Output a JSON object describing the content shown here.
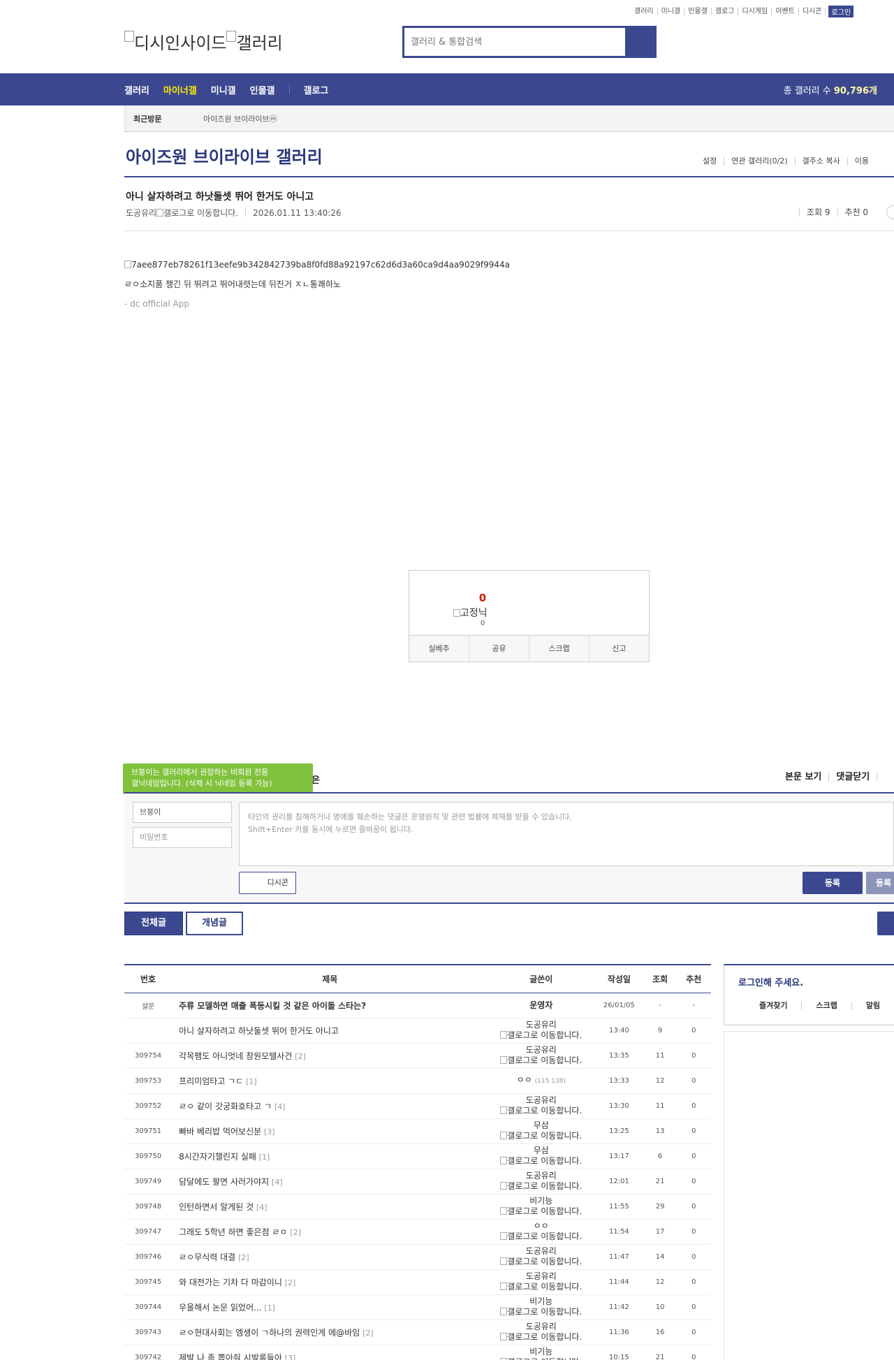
{
  "top_util": {
    "items": [
      "갤러리",
      "미니갤",
      "인물갤",
      "갤로그",
      "디시게임",
      "이벤트",
      "디시콘"
    ],
    "login": "로그인"
  },
  "logo": {
    "alt1": "디시인사이드",
    "alt2": "갤러리"
  },
  "search": {
    "placeholder": "갤러리 & 통합검색"
  },
  "gnb": {
    "items": [
      "갤러리",
      "마이너갤",
      "미니갤",
      "인물갤",
      "갤로그"
    ],
    "active": "마이너갤",
    "total_label": "총 갤러리 수",
    "total_value": "90,796개"
  },
  "recent": {
    "label": "최근방문",
    "item": "아이즈원 브이라이브",
    "badge": "ⓜ"
  },
  "gallery": {
    "title": "아이즈원 브이라이브 갤러리",
    "links": [
      "설정",
      "연관 갤러리(0/2)",
      "갤주소 복사",
      "이용"
    ]
  },
  "post": {
    "title": "아니 살자하려고 하낫둘셋 뛰어 한거도 아니고",
    "writer": "도공유리",
    "gallog_alt": "갤로그로 이동합니다.",
    "datetime": "2026.01.11 13:40:26",
    "views": "조회 9",
    "recommends": "추천 0",
    "image_alt": "7aee877eb78261f13eefe9b342842739ba8f0fd88a92197c62d6d3a60ca9d4aa9029f9944a",
    "body": "ㄹㅇ소지품 챙긴 뒤 뛰려고 뛰어내렷는데 뒤진거 ㅈㄴ통쾌하노",
    "app": "- dc official App"
  },
  "recommend_box": {
    "count": "0",
    "nick_alt": "고정닉",
    "fixed_count": "0",
    "buttons": [
      "실베추",
      "공유",
      "스크랩",
      "신고"
    ]
  },
  "comment": {
    "tooltip_line1": "브붕이는 갤러리에서 권장하는 비회원 전용",
    "tooltip_line2": "갤닉네임입니다. (삭제 시 닉네임 등록 가능)",
    "partial_label": "은",
    "links": [
      "본문 보기",
      "댓글닫기"
    ],
    "nick_value": "브붕이",
    "pw_placeholder": "비밀번호",
    "textarea_line1": "타인의 권리를 침해하거나 명예를 훼손하는 댓글은 운영원칙 및 관련 법률에 제재를 받을 수 있습니다.",
    "textarea_line2": "Shift+Enter 키를 동시에 누르면 줄바꿈이 됩니다.",
    "dccon": "디시콘",
    "register": "등록",
    "register2": "등록"
  },
  "tabs": {
    "all": "전체글",
    "concept": "개념글"
  },
  "list": {
    "headers": [
      "번호",
      "제목",
      "글쓴이",
      "작성일",
      "조회",
      "추천"
    ],
    "notice": {
      "num": "설문",
      "subject": "주류 모델하면 매출 폭등시킬 것 같은 아이돌 스타는?",
      "writer": "운영자",
      "date": "26/01/05",
      "views": "-",
      "rec": "-"
    },
    "rows": [
      {
        "num": "",
        "subject": "아니 살자하려고 하낫둘셋 뛰어 한거도 아니고",
        "reply": "",
        "writer": "도공유리",
        "ip": "",
        "gallog": true,
        "date": "13:40",
        "views": "9",
        "rec": "0"
      },
      {
        "num": "309754",
        "subject": "각목팸도 아니엇네 창원모텔사건",
        "reply": "[2]",
        "writer": "도공유리",
        "ip": "",
        "gallog": true,
        "date": "13:35",
        "views": "11",
        "rec": "0"
      },
      {
        "num": "309753",
        "subject": "프리미엄타고 ㄱㄷ",
        "reply": "[1]",
        "writer": "ㅇㅇ",
        "ip": "(115.138)",
        "gallog": false,
        "date": "13:33",
        "views": "12",
        "rec": "0"
      },
      {
        "num": "309752",
        "subject": "ㄹㅇ 같이 갓궁화호타고 ㄱ",
        "reply": "[4]",
        "writer": "도공유리",
        "ip": "",
        "gallog": true,
        "date": "13:30",
        "views": "11",
        "rec": "0"
      },
      {
        "num": "309751",
        "subject": "빠바 베리밥 먹어보신분",
        "reply": "[3]",
        "writer": "무삼",
        "ip": "",
        "gallog": true,
        "date": "13:25",
        "views": "13",
        "rec": "0"
      },
      {
        "num": "309750",
        "subject": "8시간자기챌린지 실패",
        "reply": "[1]",
        "writer": "무삼",
        "ip": "",
        "gallog": true,
        "date": "13:17",
        "views": "6",
        "rec": "0"
      },
      {
        "num": "309749",
        "subject": "담달에도 팔면 사러가야지",
        "reply": "[4]",
        "writer": "도공유리",
        "ip": "",
        "gallog": true,
        "date": "12:01",
        "views": "21",
        "rec": "0"
      },
      {
        "num": "309748",
        "subject": "인턴하면서 알게된 것",
        "reply": "[4]",
        "writer": "비기능",
        "ip": "",
        "gallog": true,
        "date": "11:55",
        "views": "29",
        "rec": "0"
      },
      {
        "num": "309747",
        "subject": "그래도 5학년 하면 좋은점 ㄹㅇ",
        "reply": "[2]",
        "writer": "ㅇㅇ",
        "ip": "",
        "gallog": true,
        "date": "11:54",
        "views": "17",
        "rec": "0"
      },
      {
        "num": "309746",
        "subject": "ㄹㅇ무식력 대결",
        "reply": "[2]",
        "writer": "도공유리",
        "ip": "",
        "gallog": true,
        "date": "11:47",
        "views": "14",
        "rec": "0"
      },
      {
        "num": "309745",
        "subject": "와 대전가는 기차 다 마감이니",
        "reply": "[2]",
        "writer": "도공유리",
        "ip": "",
        "gallog": true,
        "date": "11:44",
        "views": "12",
        "rec": "0"
      },
      {
        "num": "309744",
        "subject": "우울해서 논문 읽었어...",
        "reply": "[1]",
        "writer": "비기능",
        "ip": "",
        "gallog": true,
        "date": "11:42",
        "views": "10",
        "rec": "0"
      },
      {
        "num": "309743",
        "subject": "ㄹㅇ현대사회는 엠생이 ㄱ하나의 권력인게 에@바임",
        "reply": "[2]",
        "writer": "도공유리",
        "ip": "",
        "gallog": true,
        "date": "11:36",
        "views": "16",
        "rec": "0"
      },
      {
        "num": "309742",
        "subject": "제발 나 좀 뽑아줘 시발롬들아",
        "reply": "[3]",
        "writer": "비기능",
        "ip": "",
        "gallog": true,
        "date": "10:15",
        "views": "21",
        "rec": "0"
      }
    ]
  },
  "side": {
    "login_title": "로그인해 주세요.",
    "login_links": [
      "즐겨찾기",
      "스크랩",
      "알림"
    ]
  },
  "colors": {
    "brand": "#3b4890",
    "active_menu": "#ffed00",
    "tooltip": "#81c23c",
    "rec_count": "#d31900"
  }
}
